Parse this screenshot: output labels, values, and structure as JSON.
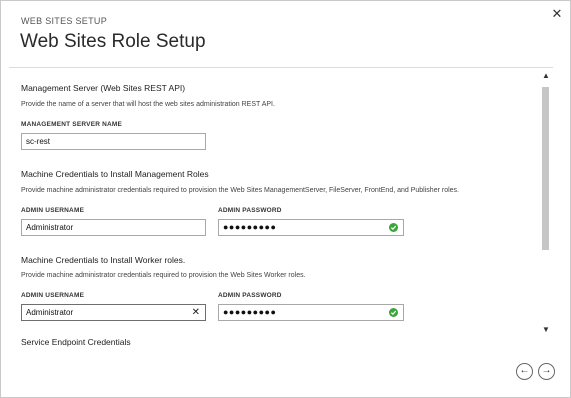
{
  "wizard": {
    "subtitle": "WEB SITES SETUP",
    "title": "Web Sites Role Setup",
    "close_icon": "✕"
  },
  "management_server": {
    "section_title": "Management Server (Web Sites REST API)",
    "description": "Provide the name of a server that will host the web sites administration REST API.",
    "field_label": "MANAGEMENT SERVER NAME",
    "value": "sc-rest"
  },
  "management_credentials": {
    "section_title": "Machine Credentials to Install Management Roles",
    "description": "Provide machine administrator credentials required to provision the Web Sites ManagementServer, FileServer, FrontEnd, and Publisher roles.",
    "username_label": "ADMIN USERNAME",
    "username_value": "Administrator",
    "password_label": "ADMIN PASSWORD",
    "password_mask": "●●●●●●●●●"
  },
  "worker_credentials": {
    "section_title": "Machine Credentials to Install Worker roles.",
    "description": "Provide machine administrator credentials required to provision the Web Sites Worker roles.",
    "username_label": "ADMIN USERNAME",
    "username_value": "Administrator",
    "password_label": "ADMIN PASSWORD",
    "password_mask": "●●●●●●●●●",
    "clear_icon": "✕"
  },
  "service_endpoint": {
    "section_title": "Service Endpoint Credentials"
  },
  "scrollbar": {
    "up": "▲",
    "down": "▼"
  },
  "navigation": {
    "back": "←",
    "next": "→"
  },
  "colors": {
    "valid_check": "#3aa53a"
  }
}
